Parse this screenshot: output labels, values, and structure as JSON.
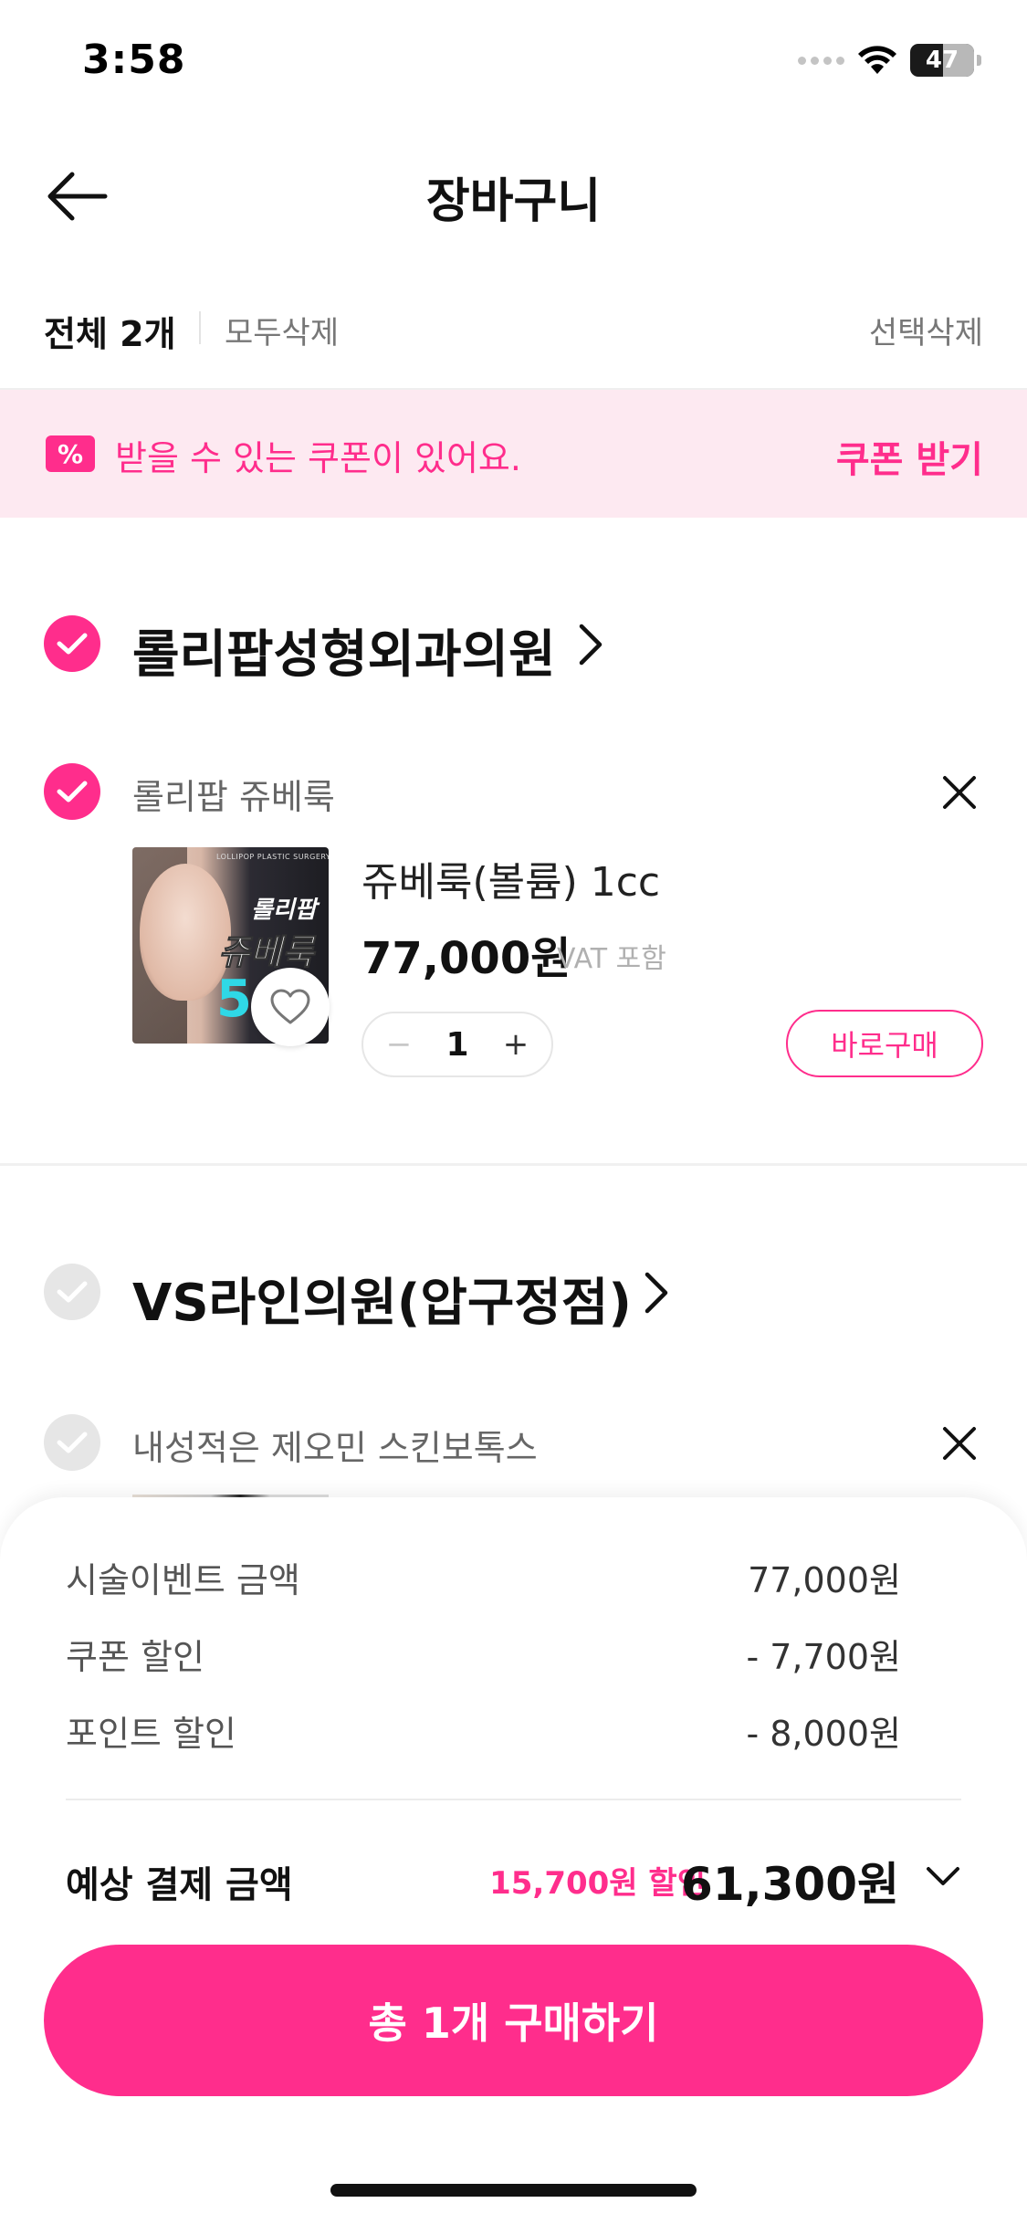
{
  "status_bar": {
    "time": "3:58",
    "battery": "47"
  },
  "nav": {
    "title": "장바구니"
  },
  "selection": {
    "select_all": "전체 2개",
    "delete_all": "모두삭제",
    "delete_selected": "선택삭제"
  },
  "coupon_banner": {
    "icon": "%",
    "text": "받을 수 있는 쿠폰이 있어요.",
    "action": "쿠폰 받기"
  },
  "clinics": [
    {
      "name": "롤리팝성형외과의원",
      "checked": true,
      "items": [
        {
          "label": "롤리팝 쥬베룩",
          "checked": true,
          "product_name": "쥬베룩(볼륨) 1cc",
          "price": "77,000원",
          "vat": "VAT 포함",
          "quantity": "1",
          "qty_minus": "−",
          "qty_plus": "+",
          "buy_now": "바로구매",
          "thumbnail": {
            "brand": "LOLLIPOP PLASTIC SURGERY",
            "line1": "롤리팝",
            "line2": "쥬베룩",
            "number": "5"
          }
        }
      ]
    },
    {
      "name": "VS라인의원(압구정점)",
      "checked": false,
      "items": [
        {
          "label": "내성적은 제오민 스킨보톡스",
          "checked": false
        }
      ]
    }
  ],
  "summary": {
    "rows": [
      {
        "label": "시술이벤트 금액",
        "value": "77,000원"
      },
      {
        "label": "쿠폰 할인",
        "value": "- 7,700원"
      },
      {
        "label": "포인트 할인",
        "value": "- 8,000원"
      }
    ],
    "total_label": "예상 결제 금액",
    "total_discount": "15,700원 할인",
    "total_amount": "61,300원"
  },
  "cta": {
    "label": "총 1개 구매하기"
  },
  "colors": {
    "accent": "#ff2d8c",
    "banner_bg": "#fde9f1",
    "unchecked": "#e6e6e6"
  }
}
